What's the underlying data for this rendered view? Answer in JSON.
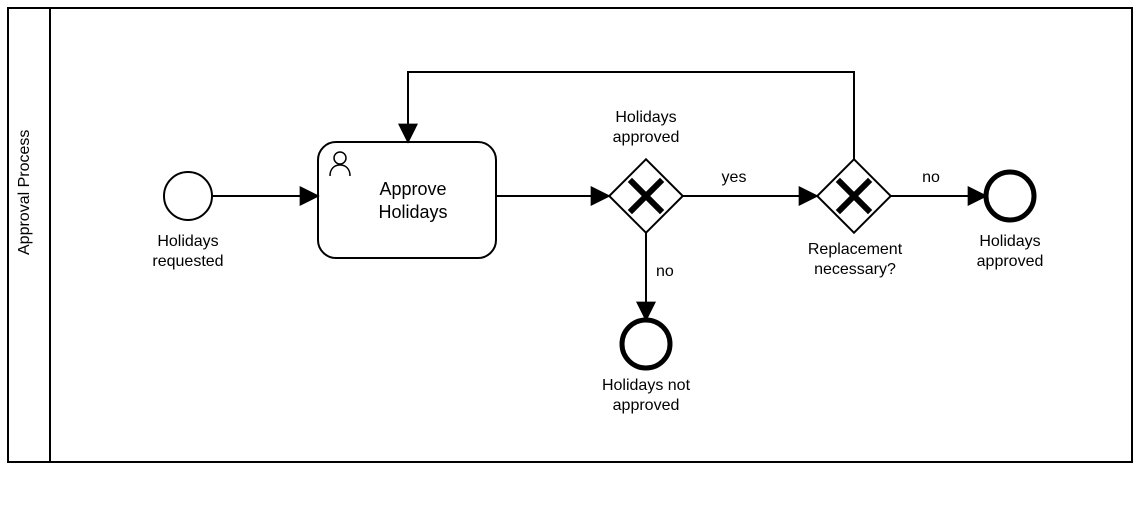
{
  "pool": {
    "title": "Approval Process"
  },
  "events": {
    "start": {
      "label": "Holidays\nrequested"
    },
    "end_not_approved": {
      "label": "Holidays not\napproved"
    },
    "end_approved": {
      "label": "Holidays\napproved"
    }
  },
  "tasks": {
    "approve_holidays": {
      "label": "Approve\nHolidays",
      "icon": "user-icon"
    }
  },
  "gateways": {
    "holidays_approved": {
      "label": "Holidays\napproved"
    },
    "replacement_necessary": {
      "label": "Replacement\nnecessary?"
    }
  },
  "flow_labels": {
    "g1_yes": "yes",
    "g1_no": "no",
    "g2_no": "no"
  }
}
